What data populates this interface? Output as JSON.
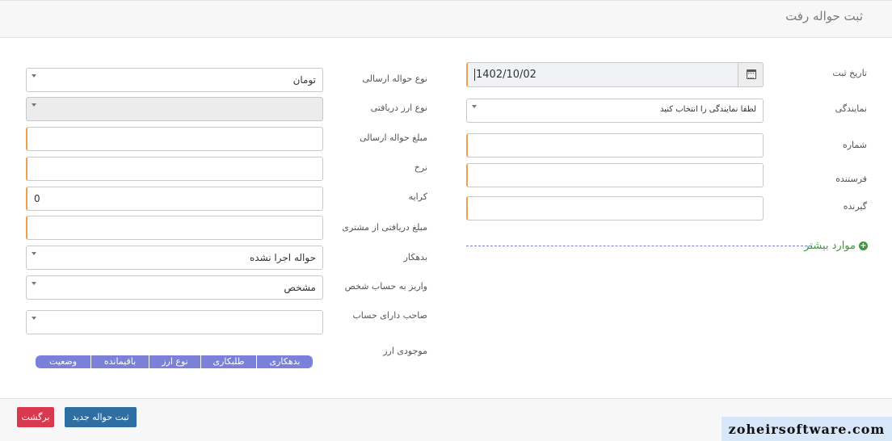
{
  "page": {
    "title": "ثبت حواله رفت"
  },
  "right_form": {
    "date_label": "تاریخ ثبت",
    "date_value": "1402/10/02",
    "agency_label": "نمایندگی",
    "agency_placeholder": "لطفا نمایندگی را انتخاب کنید",
    "number_label": "شماره",
    "sender_label": "فرستنده",
    "receiver_label": "گیرنده",
    "more_label": "موارد بیشتر"
  },
  "left_form": {
    "send_type_label": "نوع حواله ارسالی",
    "send_type_value": "تومان",
    "recv_currency_label": "نوع ارز دریافتی",
    "send_amount_label": "مبلغ حواله ارسالی",
    "rate_label": "نرخ",
    "fee_label": "کرایه",
    "fee_value": "0",
    "received_label": "مبلغ دریافتی از مشتری",
    "debtor_label": "بدهکار",
    "debtor_value": "حواله اجرا نشده",
    "deposit_label": "واریز به حساب شخص",
    "deposit_value": "مشخص",
    "account_owner_label": "صاحب دارای حساب",
    "balance_label": "موجودی ارز"
  },
  "balance_table": {
    "headers": [
      "بدهکاری",
      "طلبکاری",
      "نوع ارز",
      "باقیمانده",
      "وضعیت"
    ]
  },
  "footer": {
    "new_button": "ثبت حواله جدید",
    "back_button": "برگشت"
  },
  "watermark": "zoheirsoftware.com",
  "colors": {
    "required_accent": "#f0a050",
    "primary": "#2f6ea2",
    "danger": "#d9394e",
    "table_header": "#7b81d8",
    "more_link": "#3a9a3a"
  }
}
